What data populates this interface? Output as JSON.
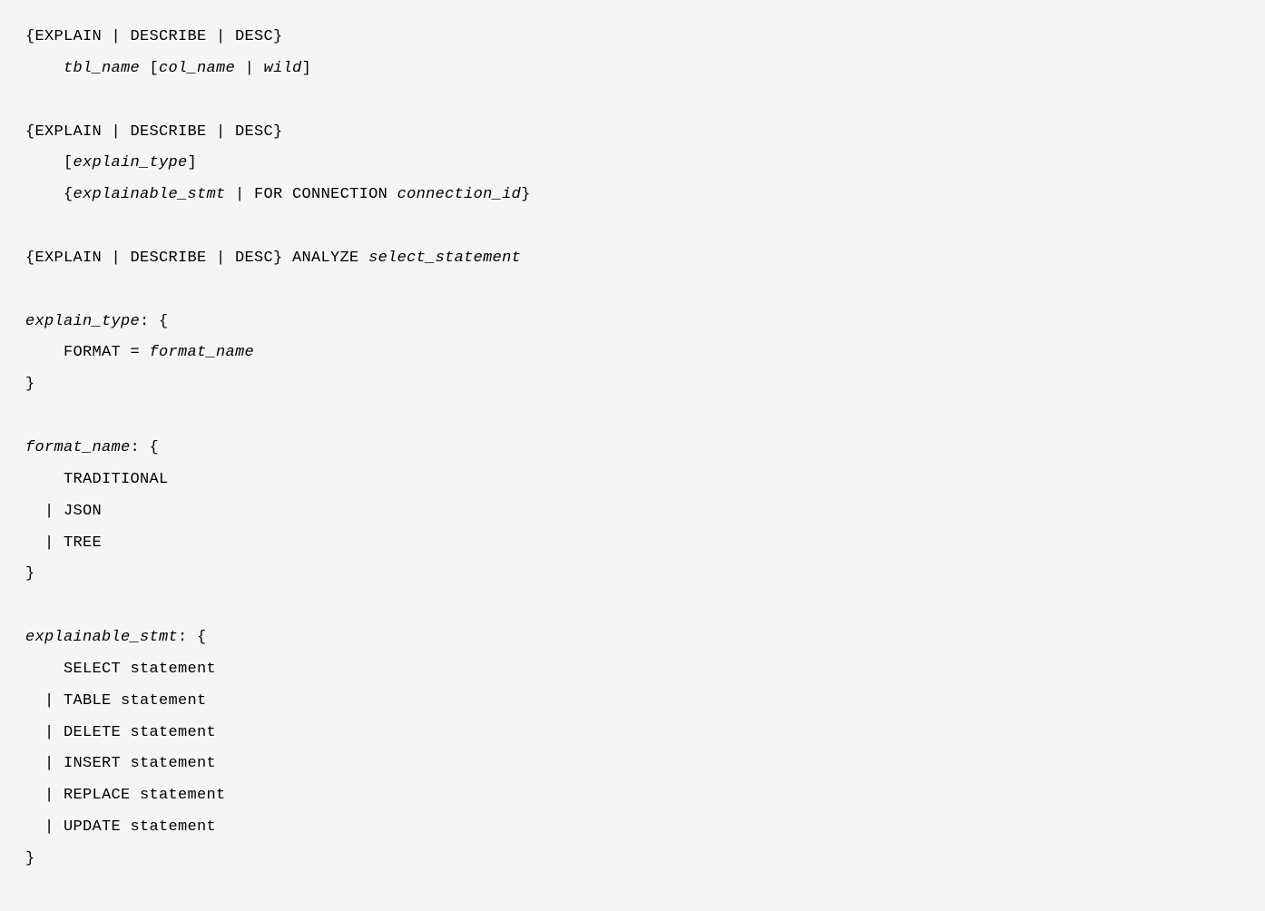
{
  "syntax": {
    "line1": "{EXPLAIN | DESCRIBE | DESC}",
    "line2_indent": "    ",
    "line2_tbl": "tbl_name",
    "line2_rest": " [",
    "line2_col": "col_name",
    "line2_pipe": " | ",
    "line2_wild": "wild",
    "line2_close": "]",
    "line3": "",
    "line4": "{EXPLAIN | DESCRIBE | DESC}",
    "line5_indent": "    [",
    "line5_expl": "explain_type",
    "line5_close": "]",
    "line6_indent": "    {",
    "line6_stmt": "explainable_stmt",
    "line6_mid": " | FOR CONNECTION ",
    "line6_conn": "connection_id",
    "line6_close": "}",
    "line7": "",
    "line8_pre": "{EXPLAIN | DESCRIBE | DESC} ANALYZE ",
    "line8_sel": "select_statement",
    "line9": "",
    "line10_et": "explain_type",
    "line10_rest": ": {",
    "line11_indent": "    FORMAT = ",
    "line11_fn": "format_name",
    "line12": "}",
    "line13": "",
    "line14_fn": "format_name",
    "line14_rest": ": {",
    "line15": "    TRADITIONAL",
    "line16": "  | JSON",
    "line17": "  | TREE",
    "line18": "}",
    "line19": "",
    "line20_es": "explainable_stmt",
    "line20_rest": ": {",
    "line21": "    SELECT statement",
    "line22": "  | TABLE statement",
    "line23": "  | DELETE statement",
    "line24": "  | INSERT statement",
    "line25": "  | REPLACE statement",
    "line26": "  | UPDATE statement",
    "line27": "}"
  }
}
